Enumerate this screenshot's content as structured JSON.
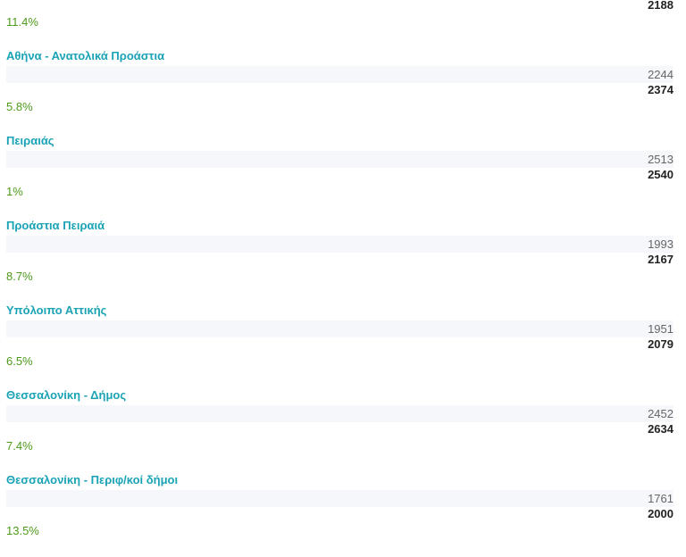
{
  "top": {
    "new": "2188",
    "pct": "11.4%"
  },
  "regions": [
    {
      "name": "Αθήνα - Ανατολικά Προάστια",
      "old": "2244",
      "new": "2374",
      "pct": "5.8%"
    },
    {
      "name": "Πειραιάς",
      "old": "2513",
      "new": "2540",
      "pct": "1%"
    },
    {
      "name": "Προάστια Πειραιά",
      "old": "1993",
      "new": "2167",
      "pct": "8.7%"
    },
    {
      "name": "Υπόλοιπο Αττικής",
      "old": "1951",
      "new": "2079",
      "pct": "6.5%"
    },
    {
      "name": "Θεσσαλονίκη - Δήμος",
      "old": "2452",
      "new": "2634",
      "pct": "7.4%"
    },
    {
      "name": "Θεσσαλονίκη - Περιφ/κοί δήμοι",
      "old": "1761",
      "new": "2000",
      "pct": "13.5%"
    }
  ],
  "colors": {
    "title": "#1aa3b5",
    "pct": "#4c9a1a",
    "row_bg": "#f6f7fb"
  }
}
